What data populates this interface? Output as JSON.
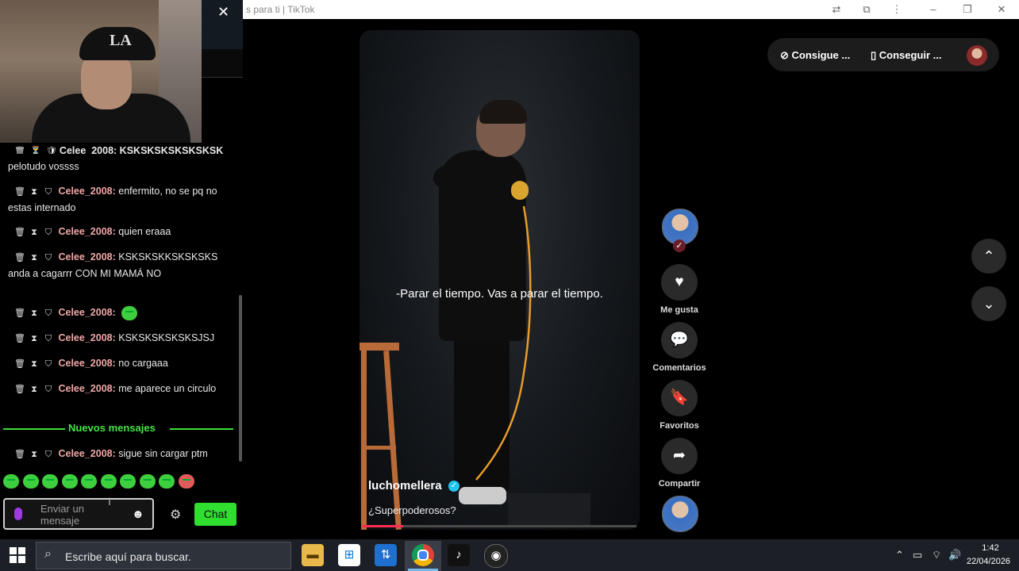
{
  "browser": {
    "tab_title": "s para ti | TikTok"
  },
  "webcam": {
    "cap_logo": "LA"
  },
  "chat": {
    "messages": [
      {
        "user": "",
        "text": "pelotudo vossss"
      },
      {
        "user": "Celee_2008:",
        "text": "enfermito, no se pq no estas internado"
      },
      {
        "user": "Celee_2008:",
        "text": "quien eraaa"
      },
      {
        "user": "Celee_2008:",
        "text": "KSKSKSKKSKSKSKS anda a cagarrr CON MI MAMÁ NO"
      },
      {
        "user": "Celee_2008:",
        "text": ""
      },
      {
        "user": "Celee_2008:",
        "text": "KSKSKSKSKSKSJSJ"
      },
      {
        "user": "Celee_2008:",
        "text": "no cargaaa"
      },
      {
        "user": "Celee_2008:",
        "text": "me aparece un circulo"
      },
      {
        "user": "Celee_2008:",
        "text": "sigue sin cargar ptm"
      }
    ],
    "partial_top": "Celee_2008: KSKSKSKSKSKSKSK",
    "new_messages_label": "Nuevos mensajes",
    "input_placeholder": "Enviar un mensaje",
    "chat_button": "Chat",
    "emotes": [
      "emote-1",
      "emote-2",
      "emote-3",
      "emote-4",
      "emote-5",
      "emote-6",
      "emote-7",
      "emote-8",
      "emote-9",
      "emote-10"
    ]
  },
  "video": {
    "subtitle": "-Parar el tiempo. Vas a parar el tiempo.",
    "creator": "luchomellera",
    "caption": "¿Superpoderosos?",
    "progress_fraction": 0.15
  },
  "actions": {
    "like": "Me gusta",
    "comments": "Comentarios",
    "favorites": "Favoritos",
    "share": "Compartir"
  },
  "top_pill": {
    "coins": "Consigue ...",
    "app": "Conseguir ..."
  },
  "taskbar": {
    "search_text": "Escribe aquí para buscar.",
    "time": "1:42",
    "date": "22/04/2026"
  },
  "colors": {
    "accent_green": "#2fde2f",
    "tiktok_red": "#fe2c55",
    "username": "#f0a7a7"
  }
}
